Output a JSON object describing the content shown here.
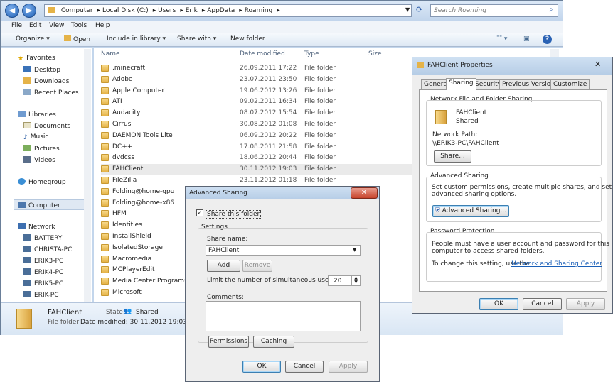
{
  "explorer": {
    "breadcrumb": [
      "Computer",
      "Local Disk (C:)",
      "Users",
      "Erik",
      "AppData",
      "Roaming"
    ],
    "search_placeholder": "Search Roaming",
    "menu": [
      "File",
      "Edit",
      "View",
      "Tools",
      "Help"
    ],
    "commands": {
      "organize": "Organize",
      "open": "Open",
      "include": "Include in library",
      "share": "Share with",
      "new_folder": "New folder"
    },
    "nav": {
      "favorites": "Favorites",
      "desktop": "Desktop",
      "downloads": "Downloads",
      "recent": "Recent Places",
      "libraries": "Libraries",
      "documents": "Documents",
      "music": "Music",
      "pictures": "Pictures",
      "videos": "Videos",
      "homegroup": "Homegroup",
      "computer": "Computer",
      "network": "Network",
      "pcs": [
        "BATTERY",
        "CHRISTA-PC",
        "ERIK3-PC",
        "ERIK4-PC",
        "ERIK5-PC",
        "ERIK-PC"
      ]
    },
    "columns": {
      "name": "Name",
      "date": "Date modified",
      "type": "Type",
      "size": "Size"
    },
    "files": [
      {
        "name": ".minecraft",
        "date": "26.09.2011 17:22",
        "type": "File folder"
      },
      {
        "name": "Adobe",
        "date": "23.07.2011 23:50",
        "type": "File folder"
      },
      {
        "name": "Apple Computer",
        "date": "19.06.2012 13:26",
        "type": "File folder"
      },
      {
        "name": "ATI",
        "date": "09.02.2011 16:34",
        "type": "File folder"
      },
      {
        "name": "Audacity",
        "date": "08.07.2012 15:54",
        "type": "File folder"
      },
      {
        "name": "Cirrus",
        "date": "30.08.2012 01:08",
        "type": "File folder"
      },
      {
        "name": "DAEMON Tools Lite",
        "date": "06.09.2012 20:22",
        "type": "File folder"
      },
      {
        "name": "DC++",
        "date": "17.08.2011 21:58",
        "type": "File folder"
      },
      {
        "name": "dvdcss",
        "date": "18.06.2012 20:44",
        "type": "File folder"
      },
      {
        "name": "FAHClient",
        "date": "30.11.2012 19:03",
        "type": "File folder"
      },
      {
        "name": "FileZilla",
        "date": "23.11.2012 01:18",
        "type": "File folder"
      },
      {
        "name": "Folding@home-gpu",
        "date": "",
        "type": ""
      },
      {
        "name": "Folding@home-x86",
        "date": "",
        "type": ""
      },
      {
        "name": "HFM",
        "date": "",
        "type": ""
      },
      {
        "name": "Identities",
        "date": "",
        "type": ""
      },
      {
        "name": "InstallShield",
        "date": "",
        "type": ""
      },
      {
        "name": "IsolatedStorage",
        "date": "",
        "type": ""
      },
      {
        "name": "Macromedia",
        "date": "",
        "type": ""
      },
      {
        "name": "MCPlayerEdit",
        "date": "",
        "type": ""
      },
      {
        "name": "Media Center Programs",
        "date": "",
        "type": ""
      },
      {
        "name": "Microsoft",
        "date": "",
        "type": ""
      }
    ],
    "details": {
      "name": "FAHClient",
      "kind": "File folder",
      "state_label": "State:",
      "state": "Shared",
      "modified": "Date modified: 30.11.2012 19:03"
    }
  },
  "advanced": {
    "title": "Advanced Sharing",
    "share_checkbox": "Share this folder",
    "settings": "Settings",
    "share_name_label": "Share name:",
    "share_name": "FAHClient",
    "add": "Add",
    "remove": "Remove",
    "limit_label": "Limit the number of simultaneous users to:",
    "limit_value": "20",
    "comments_label": "Comments:",
    "permissions": "Permissions",
    "caching": "Caching",
    "ok": "OK",
    "cancel": "Cancel",
    "apply": "Apply"
  },
  "properties": {
    "title": "FAHClient Properties",
    "tabs": [
      "General",
      "Sharing",
      "Security",
      "Previous Versions",
      "Customize"
    ],
    "nfs_heading": "Network File and Folder Sharing",
    "folder_name": "FAHClient",
    "folder_state": "Shared",
    "path_label": "Network Path:",
    "path": "\\\\ERIK3-PC\\FAHClient",
    "share_btn": "Share...",
    "adv_heading": "Advanced Sharing",
    "adv_text1": "Set custom permissions, create multiple shares, and set other",
    "adv_text2": "advanced sharing options.",
    "adv_btn": "Advanced Sharing...",
    "pw_heading": "Password Protection",
    "pw_text1": "People must have a user account and password for this",
    "pw_text2": "computer to access shared folders.",
    "pw_text3": "To change this setting, use the",
    "pw_link": "Network and Sharing Center",
    "ok": "OK",
    "cancel": "Cancel",
    "apply": "Apply"
  }
}
